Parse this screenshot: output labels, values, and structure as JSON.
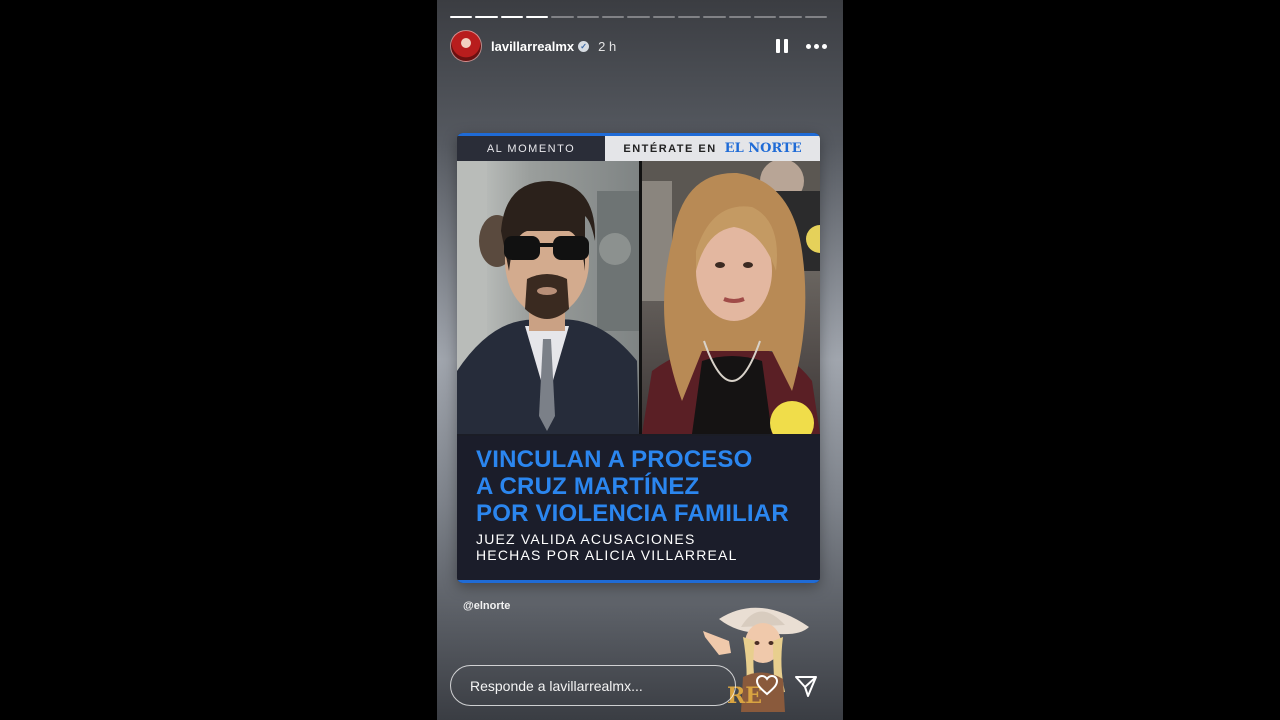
{
  "story": {
    "progress": {
      "total_segments": 15,
      "completed_segments": 4
    },
    "username": "lavillarrealmx",
    "time": "2 h",
    "verified_icon": "verified-badge-icon",
    "controls": {
      "pause_icon": "pause-icon",
      "more_icon": "more-options-icon"
    }
  },
  "post": {
    "topbar_left": "AL MOMENTO",
    "topbar_right_prefix": "ENTÉRATE EN",
    "brand": "EL NORTE",
    "headline_lines": [
      "VINCULAN A PROCESO",
      "A CRUZ MARTÍNEZ",
      "POR VIOLENCIA FAMILIAR"
    ],
    "subhead_lines": [
      "JUEZ VALIDA ACUSACIONES",
      "HECHAS POR ALICIA VILLARREAL"
    ],
    "accent_color": "#2b86ef",
    "brand_color": "#1f6bd6"
  },
  "mention": "@elnorte",
  "sticker": {
    "icon": "cowgirl-sticker-icon"
  },
  "reply": {
    "placeholder": "Responde a lavillarrealmx..."
  },
  "actions": {
    "like_icon": "heart-icon",
    "share_icon": "send-icon"
  }
}
